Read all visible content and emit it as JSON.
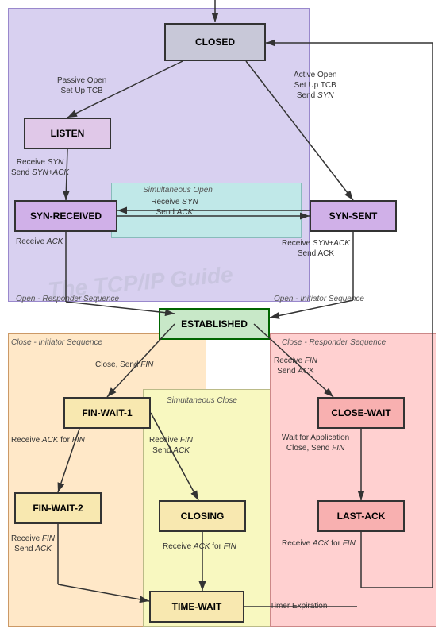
{
  "states": {
    "closed": "CLOSED",
    "listen": "LISTEN",
    "syn_received": "SYN-RECEIVED",
    "syn_sent": "SYN-SENT",
    "established": "ESTABLISHED",
    "fin_wait_1": "FIN-WAIT-1",
    "fin_wait_2": "FIN-WAIT-2",
    "closing": "CLOSING",
    "close_wait": "CLOSE-WAIT",
    "last_ack": "LAST-ACK",
    "time_wait": "TIME-WAIT"
  },
  "labels": {
    "passive_open": "Passive Open\nSet Up TCB",
    "active_open": "Active Open\nSet Up TCB\nSend SYN",
    "receive_syn_send_synack": "Receive SYN\nSend SYN+ACK",
    "simultaneous_open": "Simultaneous Open",
    "receive_syn_send_ack": "Receive SYN\nSend ACK",
    "receive_synack_send_ack": "Receive SYN+ACK\nSend ACK",
    "receive_ack": "Receive ACK",
    "open_responder": "Open - Responder Sequence",
    "open_initiator": "Open - Initiator Sequence",
    "close_initiator": "Close - Initiator Sequence",
    "close_responder": "Close - Responder Sequence",
    "close_send_fin": "Close, Send FIN",
    "simultaneous_close": "Simultaneous Close",
    "receive_fin_send_ack_close": "Receive FIN\nSend ACK",
    "receive_ack_for_fin": "Receive ACK for FIN",
    "receive_fin_send_ack2": "Receive FIN\nSend ACK",
    "receive_fin_send_ack3": "Receive FIN\nSend ACK",
    "receive_ack_for_fin2": "Receive ACK for FIN",
    "receive_ack_for_fin3": "Receive ACK for FIN",
    "wait_app_close": "Wait for Application\nClose, Send FIN",
    "timer_expiration": "Timer Expiration"
  },
  "watermark": "The TCP/IP Guide",
  "colors": {
    "purple_bg": "#d8d0f0",
    "teal_bg": "#c0e8e8",
    "peach_bg": "#ffe8c8",
    "pink_bg": "#ffd0d0",
    "yellow_bg": "#f8f8c0"
  }
}
